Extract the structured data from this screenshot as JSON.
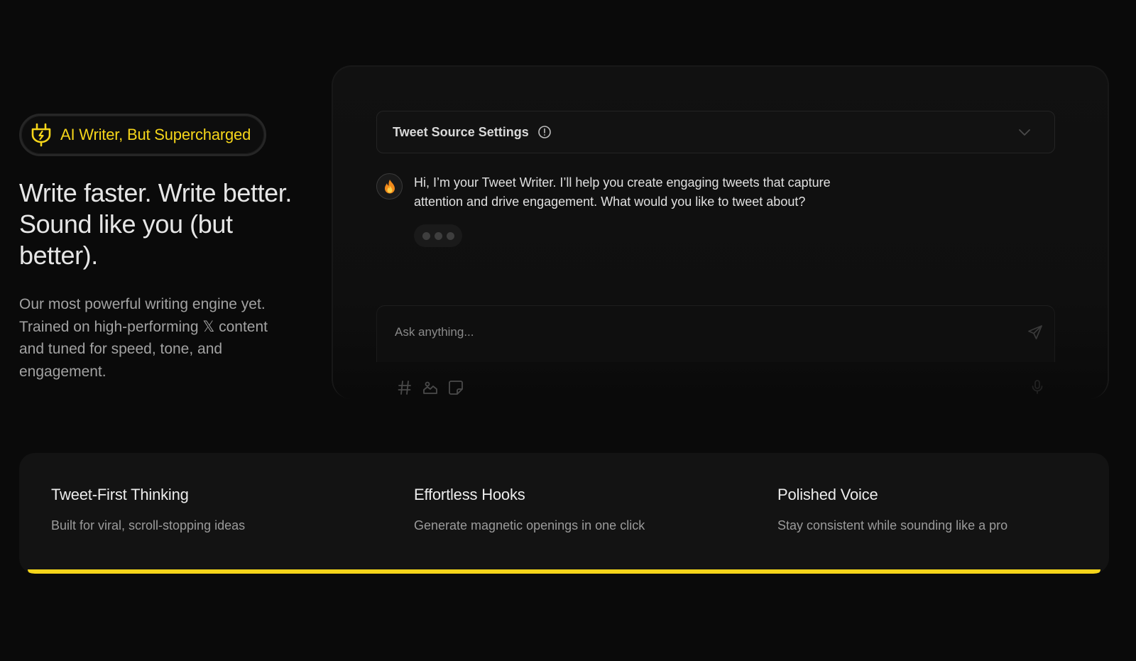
{
  "hero": {
    "badge_label": "AI Writer, But Supercharged",
    "badge_icon": "plug-icon",
    "title": "Write faster. Write better. Sound like you (but better).",
    "description": "Our most powerful writing engine yet. Trained on high-performing 𝕏 content and tuned for speed, tone, and engagement."
  },
  "chat": {
    "settings_title": "Tweet Source Settings",
    "settings_info_icon": "info-icon",
    "settings_toggle_icon": "chevron-down-icon",
    "avatar_icon": "fire-icon",
    "assistant_message": "Hi, I’m your Tweet Writer. I’ll help you create engaging tweets that capture attention and drive engagement. What would you like to tweet about?",
    "input_placeholder": "Ask anything...",
    "input_value": "",
    "tools": [
      "hashtag-icon",
      "image-icon",
      "sticker-icon"
    ],
    "send_icon": "send-icon",
    "mic_icon": "microphone-icon"
  },
  "features": [
    {
      "title": "Tweet-First Thinking",
      "description": "Built for viral, scroll-stopping ideas"
    },
    {
      "title": "Effortless Hooks",
      "description": "Generate magnetic openings in one click"
    },
    {
      "title": "Polished Voice",
      "description": "Stay consistent while sounding like a pro"
    }
  ],
  "colors": {
    "background": "#0a0a0a",
    "accent": "#f5d51a",
    "panel": "#111111",
    "card": "#131313"
  }
}
